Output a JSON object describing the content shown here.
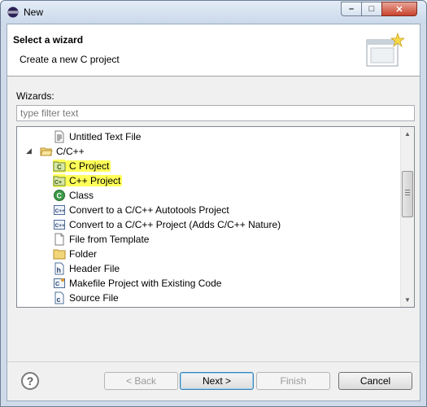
{
  "window": {
    "title": "New"
  },
  "banner": {
    "title": "Select a wizard",
    "description": "Create a new C project"
  },
  "wizards": {
    "label": "Wizards:",
    "filter_placeholder": "type filter text"
  },
  "tree": {
    "items": [
      {
        "label": "Untitled Text File",
        "icon": "text-file-icon",
        "indent": 1,
        "highlighted": false
      },
      {
        "label": "C/C++",
        "icon": "folder-open-icon",
        "indent": 0,
        "expanded": true,
        "highlighted": false
      },
      {
        "label": "C Project",
        "icon": "c-project-icon",
        "indent": 1,
        "highlighted": true
      },
      {
        "label": "C++ Project",
        "icon": "cpp-project-icon",
        "indent": 1,
        "highlighted": true
      },
      {
        "label": "Class",
        "icon": "class-icon",
        "indent": 1,
        "highlighted": false
      },
      {
        "label": "Convert to a C/C++ Autotools Project",
        "icon": "convert-icon",
        "indent": 1,
        "highlighted": false
      },
      {
        "label": "Convert to a C/C++ Project (Adds C/C++ Nature)",
        "icon": "convert-icon",
        "indent": 1,
        "highlighted": false
      },
      {
        "label": "File from Template",
        "icon": "file-icon",
        "indent": 1,
        "highlighted": false
      },
      {
        "label": "Folder",
        "icon": "folder-icon",
        "indent": 1,
        "highlighted": false
      },
      {
        "label": "Header File",
        "icon": "header-file-icon",
        "indent": 1,
        "highlighted": false
      },
      {
        "label": "Makefile Project with Existing Code",
        "icon": "makefile-project-icon",
        "indent": 1,
        "highlighted": false
      },
      {
        "label": "Source File",
        "icon": "source-file-icon",
        "indent": 1,
        "highlighted": false
      }
    ]
  },
  "buttons": {
    "back": "< Back",
    "next": "Next >",
    "finish": "Finish",
    "cancel": "Cancel",
    "help": "?"
  },
  "colors": {
    "highlight": "#ffff58",
    "title_bar": "#cbd9ea",
    "close": "#c9432d"
  }
}
